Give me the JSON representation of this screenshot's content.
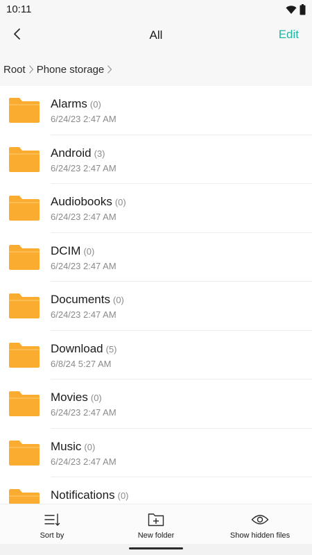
{
  "status_bar": {
    "time": "10:11"
  },
  "app_bar": {
    "title": "All",
    "edit_label": "Edit"
  },
  "breadcrumb": {
    "items": [
      "Root",
      "Phone storage"
    ]
  },
  "folders": [
    {
      "name": "Alarms",
      "count": "(0)",
      "date": "6/24/23 2:47 AM"
    },
    {
      "name": "Android",
      "count": "(3)",
      "date": "6/24/23 2:47 AM"
    },
    {
      "name": "Audiobooks",
      "count": "(0)",
      "date": "6/24/23 2:47 AM"
    },
    {
      "name": "DCIM",
      "count": "(0)",
      "date": "6/24/23 2:47 AM"
    },
    {
      "name": "Documents",
      "count": "(0)",
      "date": "6/24/23 2:47 AM"
    },
    {
      "name": "Download",
      "count": "(5)",
      "date": "6/8/24 5:27 AM"
    },
    {
      "name": "Movies",
      "count": "(0)",
      "date": "6/24/23 2:47 AM"
    },
    {
      "name": "Music",
      "count": "(0)",
      "date": "6/24/23 2:47 AM"
    },
    {
      "name": "Notifications",
      "count": "(0)",
      "date": ""
    }
  ],
  "bottom_actions": {
    "sort_by": "Sort by",
    "new_folder": "New folder",
    "show_hidden": "Show hidden files"
  },
  "colors": {
    "accent": "#1fb5a5",
    "folder": "#f9ac2f"
  },
  "icons": [
    "wifi-icon",
    "battery-icon",
    "back-arrow-icon",
    "chevron-right-icon",
    "folder-icon",
    "sort-icon",
    "new-folder-icon",
    "eye-icon"
  ]
}
